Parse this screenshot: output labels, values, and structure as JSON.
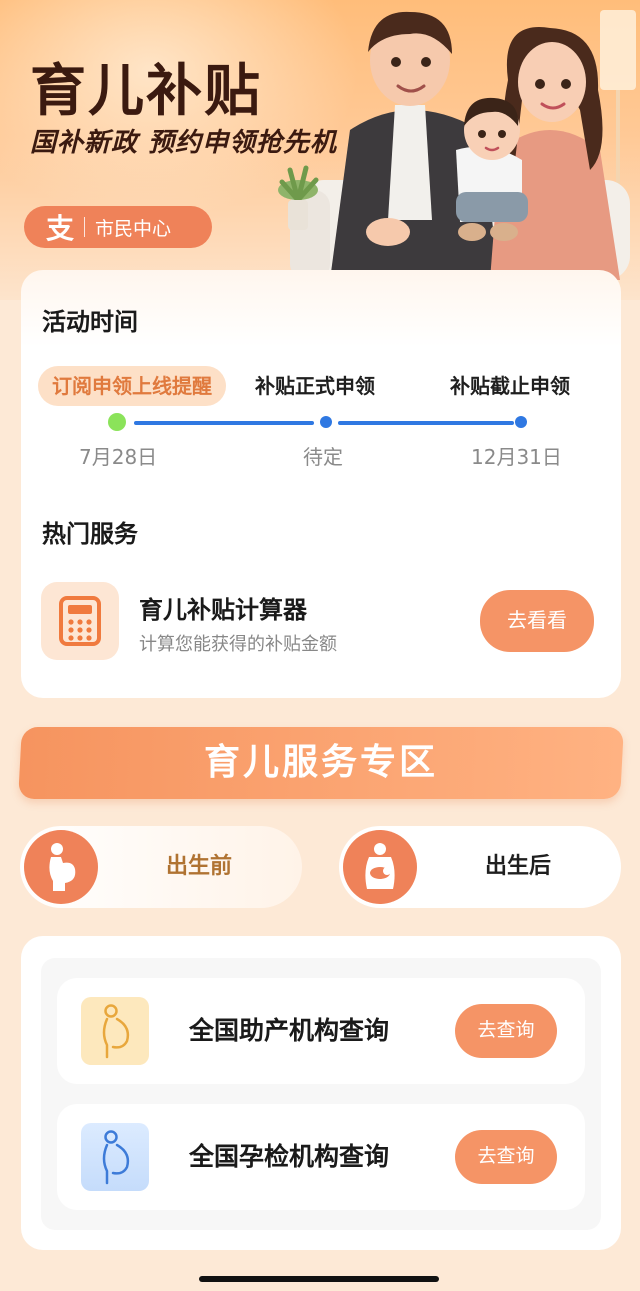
{
  "hero": {
    "title": "育儿补贴",
    "subtitle": "国补新政 预约申领抢先机",
    "badge_icon": "alipay-icon",
    "badge_icon_glyph": "支",
    "badge_label": "市民中心"
  },
  "activity": {
    "title": "活动时间",
    "steps": [
      {
        "label": "订阅申领上线提醒",
        "date": "7月28日",
        "active": true
      },
      {
        "label": "补贴正式申领",
        "date": "待定",
        "active": false
      },
      {
        "label": "补贴截止申领",
        "date": "12月31日",
        "active": false
      }
    ]
  },
  "hot_services": {
    "title": "热门服务",
    "items": [
      {
        "icon": "calculator-icon",
        "name": "育儿补贴计算器",
        "description": "计算您能获得的补贴金额",
        "button_label": "去看看"
      }
    ]
  },
  "zone": {
    "banner_title": "育儿服务专区",
    "tabs": [
      {
        "icon": "pregnant-woman-icon",
        "label": "出生前",
        "selected": true
      },
      {
        "icon": "mother-baby-icon",
        "label": "出生后",
        "selected": false
      }
    ],
    "lookups": [
      {
        "icon": "pregnant-silhouette-icon",
        "name": "全国助产机构查询",
        "button_label": "去查询"
      },
      {
        "icon": "pregnant-silhouette-icon",
        "name": "全国孕检机构查询",
        "button_label": "去查询"
      }
    ]
  },
  "colors": {
    "accent": "#f59466",
    "brand_orange": "#ef8259",
    "timeline_blue": "#2f78e2",
    "timeline_start": "#8be35a",
    "active_step_text": "#e07a3e",
    "selected_tab_text": "#b07332"
  }
}
